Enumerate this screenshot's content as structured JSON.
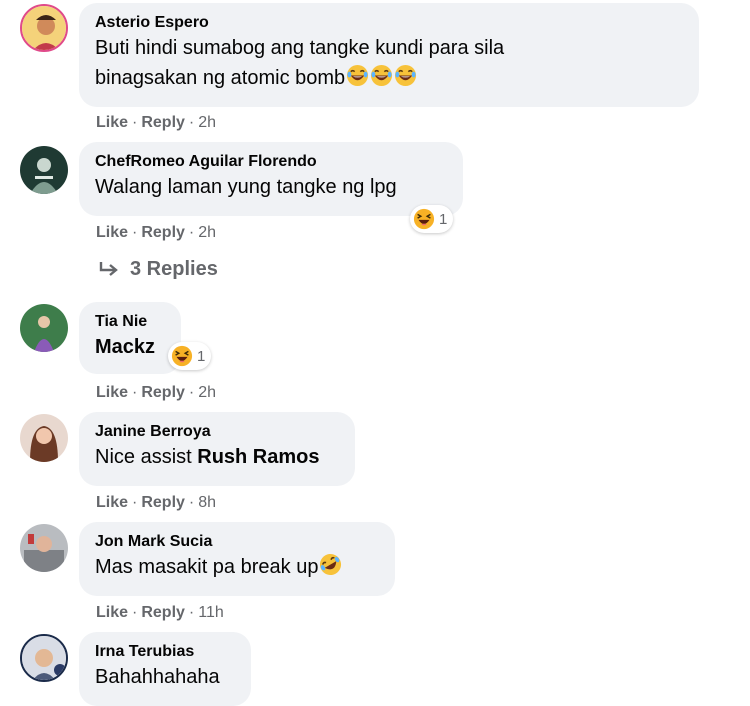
{
  "comments": [
    {
      "author": "Asterio Espero",
      "text": "Buti hindi sumabog ang tangke kundi para sila",
      "text2": "binagsakan ng atomic bomb",
      "emoji": "tears-of-joy-emoji x3",
      "like": "Like",
      "reply": "Reply",
      "time": "2h"
    },
    {
      "author": "ChefRomeo Aguilar Florendo",
      "text": "Walang laman yung tangke ng lpg",
      "reaction_count": "1",
      "like": "Like",
      "reply": "Reply",
      "time": "2h",
      "replies_label": "3 Replies"
    },
    {
      "author": "Tia Nie",
      "text": "Mackz",
      "reaction_count": "1",
      "like": "Like",
      "reply": "Reply",
      "time": "2h"
    },
    {
      "author": "Janine Berroya",
      "text": "Nice assist ",
      "mention": "Rush Ramos",
      "like": "Like",
      "reply": "Reply",
      "time": "8h"
    },
    {
      "author": "Jon Mark Sucia",
      "text": "Mas masakit pa break up",
      "emoji": "rolling-laughing-emoji",
      "like": "Like",
      "reply": "Reply",
      "time": "11h"
    },
    {
      "author": "Irna Terubias",
      "text": "Bahahhahaha"
    }
  ],
  "colors": {
    "bubble": "#f0f2f5",
    "meta": "#65676b",
    "text": "#050505",
    "emoji": "#f7b125"
  }
}
